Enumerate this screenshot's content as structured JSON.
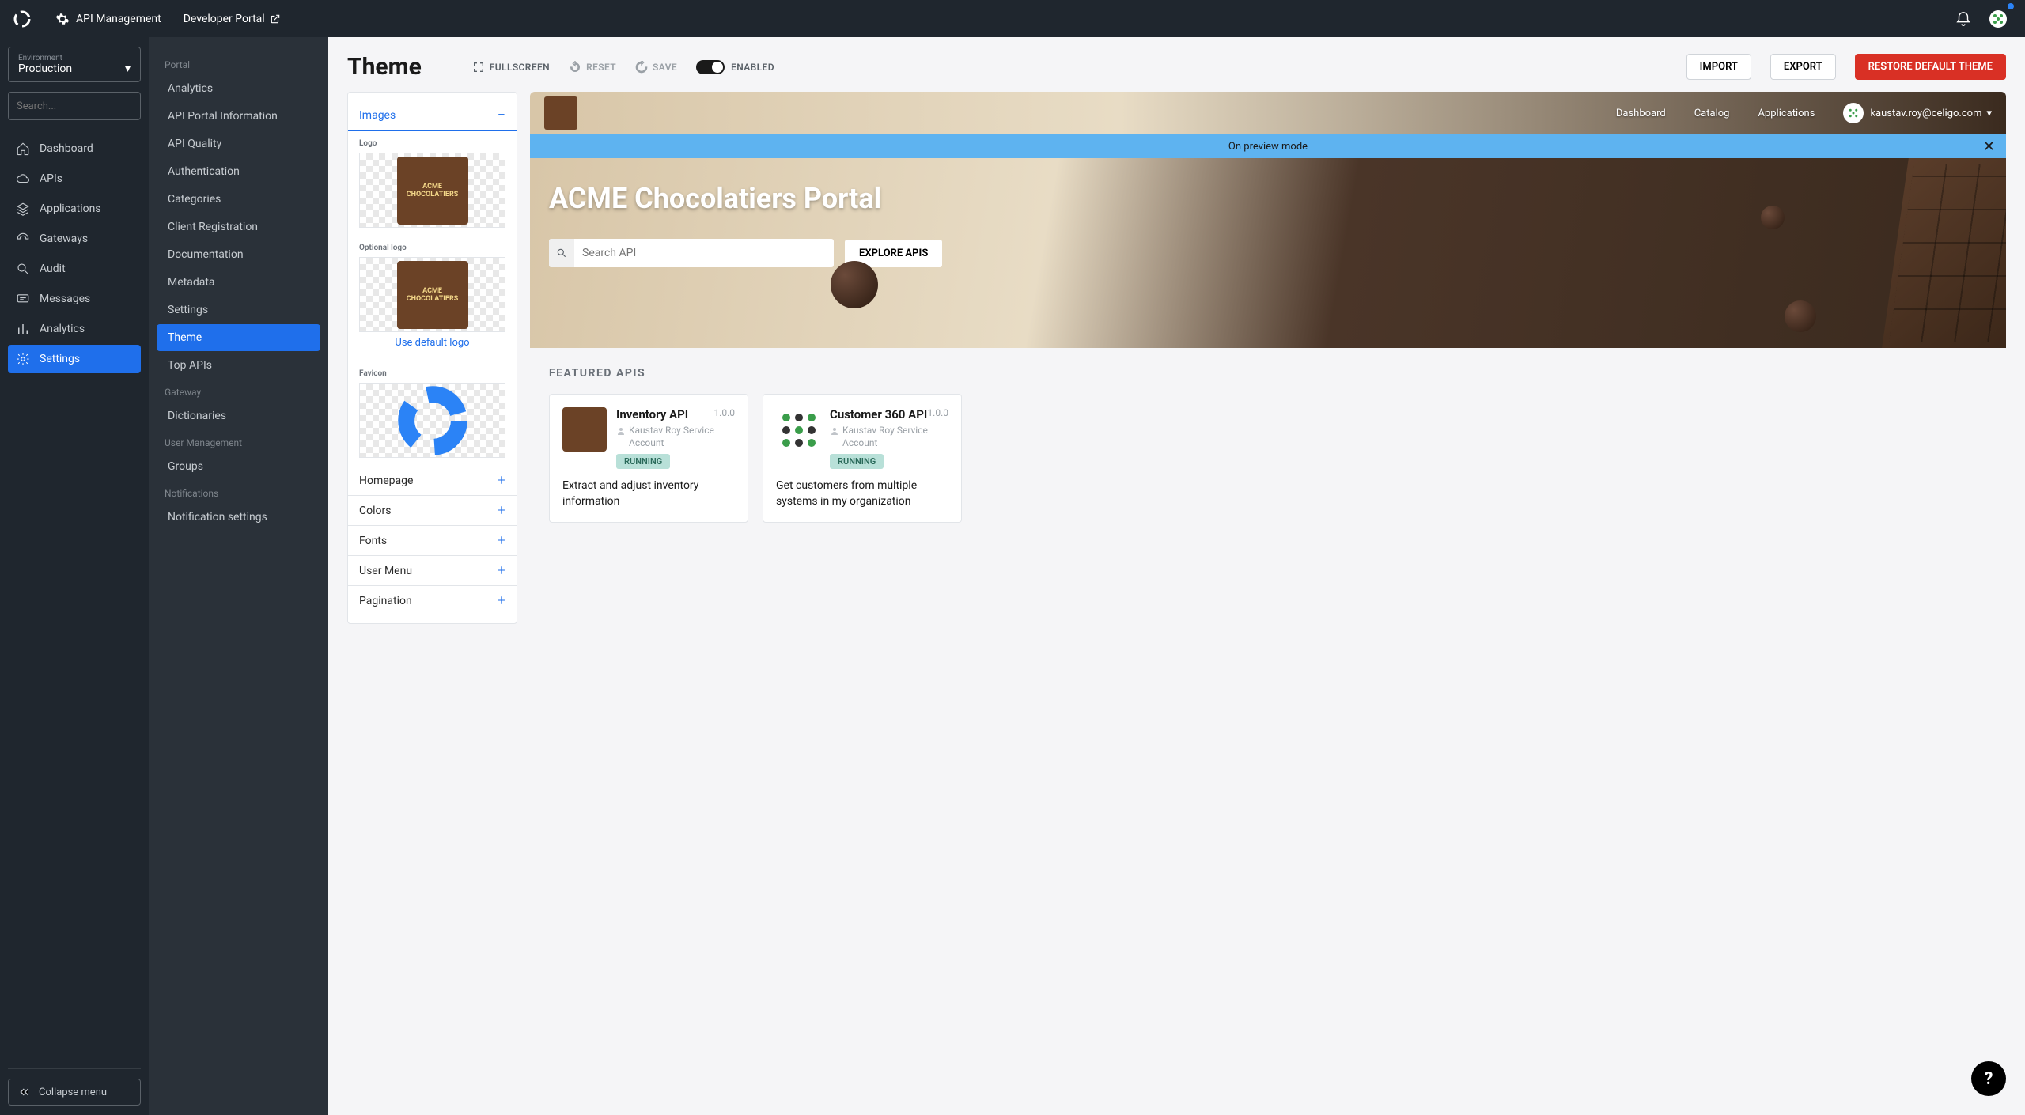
{
  "topbar": {
    "api_management": "API Management",
    "developer_portal": "Developer Portal"
  },
  "sidebar": {
    "env_label": "Environment",
    "env_value": "Production",
    "search_placeholder": "Search...",
    "items": [
      {
        "label": "Dashboard"
      },
      {
        "label": "APIs"
      },
      {
        "label": "Applications"
      },
      {
        "label": "Gateways"
      },
      {
        "label": "Audit"
      },
      {
        "label": "Messages"
      },
      {
        "label": "Analytics"
      },
      {
        "label": "Settings"
      }
    ],
    "collapse": "Collapse menu"
  },
  "subsidebar": {
    "portal_heading": "Portal",
    "portal_items": [
      "Analytics",
      "API Portal Information",
      "API Quality",
      "Authentication",
      "Categories",
      "Client Registration",
      "Documentation",
      "Metadata",
      "Settings",
      "Theme",
      "Top APIs"
    ],
    "gateway_heading": "Gateway",
    "gateway_items": [
      "Dictionaries"
    ],
    "user_heading": "User Management",
    "user_items": [
      "Groups"
    ],
    "notif_heading": "Notifications",
    "notif_items": [
      "Notification settings"
    ]
  },
  "main": {
    "title": "Theme",
    "fullscreen": "FULLSCREEN",
    "reset": "RESET",
    "save": "SAVE",
    "enabled": "ENABLED",
    "import": "IMPORT",
    "export": "EXPORT",
    "restore": "RESTORE DEFAULT THEME"
  },
  "theme_panel": {
    "sections": [
      "Images",
      "Homepage",
      "Colors",
      "Fonts",
      "User Menu",
      "Pagination"
    ],
    "logo_label": "Logo",
    "optional_logo_label": "Optional logo",
    "use_default": "Use default logo",
    "favicon_label": "Favicon"
  },
  "preview": {
    "nav": [
      "Dashboard",
      "Catalog",
      "Applications"
    ],
    "user": "kaustav.roy@celigo.com",
    "banner": "On preview mode",
    "hero_title": "ACME Chocolatiers Portal",
    "search_placeholder": "Search API",
    "explore": "EXPLORE APIS",
    "featured_heading": "FEATURED APIS",
    "cards": [
      {
        "title": "Inventory API",
        "version": "1.0.0",
        "owner": "Kaustav Roy Service Account",
        "status": "RUNNING",
        "desc": "Extract and adjust inventory information"
      },
      {
        "title": "Customer 360 API",
        "version": "1.0.0",
        "owner": "Kaustav Roy Service Account",
        "status": "RUNNING",
        "desc": "Get customers from multiple systems in my organization"
      }
    ]
  }
}
